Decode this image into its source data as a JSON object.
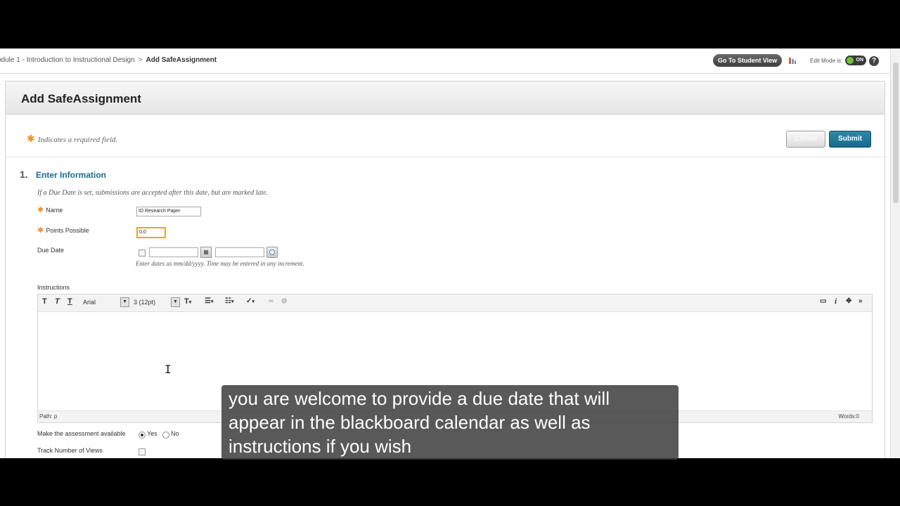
{
  "breadcrumb": {
    "parent": "odule 1 - Introduction to Instructional Design",
    "separator": ">",
    "current": "Add SafeAssignment"
  },
  "header": {
    "student_view_label": "Go To Student View",
    "edit_mode_label": "Edit Mode is:",
    "edit_mode_state": "ON",
    "help_glyph": "?"
  },
  "page": {
    "title": "Add SafeAssignment",
    "required_note": "Indicates a required field.",
    "required_glyph": "✱",
    "cancel_label": "Cancel",
    "submit_label": "Submit"
  },
  "section": {
    "number": "1.",
    "title": "Enter Information",
    "note": "If a Due Date is set, submissions are accepted after this date, but are marked late."
  },
  "form": {
    "name_label": "Name",
    "name_value": "ID Research Paper",
    "points_label": "Points Possible",
    "points_value": "0.0",
    "due_label": "Due Date",
    "due_date_value": "",
    "due_time_value": "",
    "due_hint": "Enter dates as mm/dd/yyyy. Time may be entered in any increment.",
    "instructions_label": "Instructions",
    "available_label": "Make the assessment available",
    "yes_label": "Yes",
    "no_label": "No",
    "track_label": "Track Number of Views"
  },
  "editor": {
    "font_family": "Arial",
    "font_size": "3 (12pt)",
    "path": "Path: p",
    "words": "Words:0"
  },
  "caption": {
    "line1": "you are welcome to provide a due date that will",
    "line2": "appear in the blackboard calendar as well as",
    "line3": "instructions if you wish"
  },
  "colors": {
    "accent": "#1b6c8c",
    "required": "#e8932c",
    "submit": "#176b8c"
  }
}
